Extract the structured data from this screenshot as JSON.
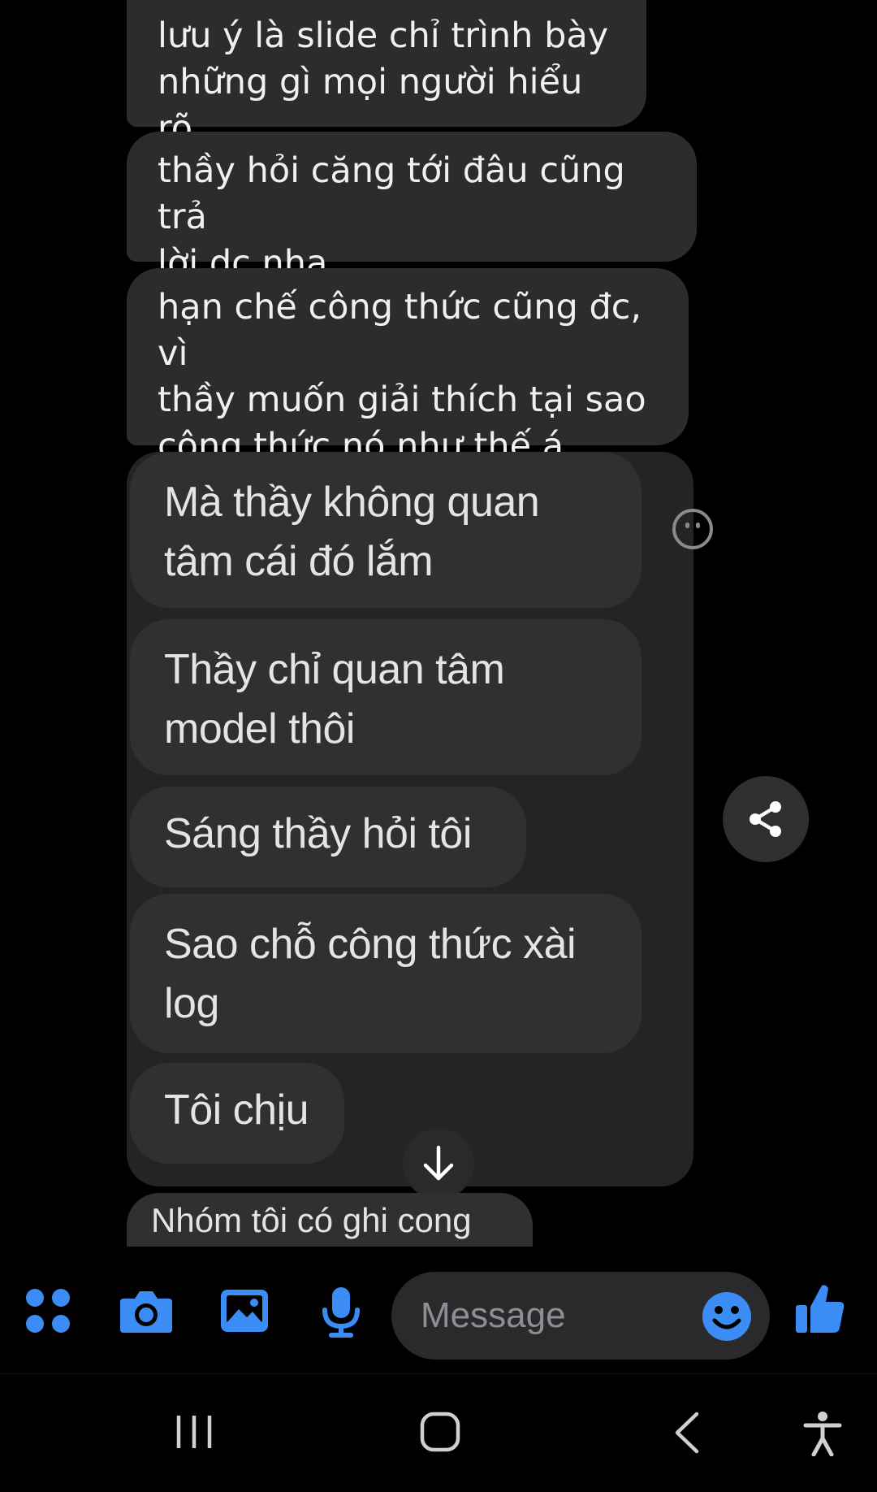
{
  "messages": [
    {
      "text": "lưu ý là slide chỉ trình bày\nnhững gì mọi người hiểu rõ"
    },
    {
      "text": "thầy hỏi căng tới đâu cũng trả\nlời dc nha"
    },
    {
      "text": "hạn chế công thức cũng đc, vì\nthầy muốn giải thích tại sao\ncông thức nó như thế á"
    }
  ],
  "shared_screenshot": {
    "bubbles": [
      {
        "text": "Mà thầy không quan\ntâm cái đó lắm"
      },
      {
        "text": "Thầy chỉ quan tâm\nmodel thôi"
      },
      {
        "text": "Sáng thầy hỏi tôi"
      },
      {
        "text": "Sao chỗ công thức xài\nlog"
      },
      {
        "text": "Tôi chịu"
      }
    ],
    "partial_bubble": "Nhóm tôi có ghi cong"
  },
  "composer": {
    "placeholder": "Message",
    "icons": [
      "apps-grid-icon",
      "camera-icon",
      "gallery-icon",
      "microphone-icon",
      "emoji-icon",
      "thumbs-up-icon"
    ],
    "accent_color": "#3b8df5"
  },
  "message_actions": {
    "share_icon": "share-icon",
    "scroll_down_icon": "arrow-down-icon",
    "reaction_icon": "smiley-react-icon"
  },
  "system_nav": {
    "icons": [
      "recent-apps-icon",
      "home-icon",
      "back-icon",
      "accessibility-icon"
    ]
  }
}
